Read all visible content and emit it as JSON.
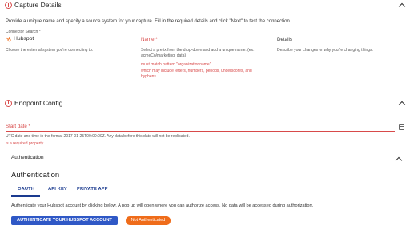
{
  "capture": {
    "title": "Capture Details",
    "intro": "Provide a unique name and specify a source system for your capture. Fill in the required details and click \"Next\" to test the connection.",
    "connector": {
      "label": "Connector Search *",
      "value": "Hubspot",
      "help": "Choose the external system you're connecting to."
    },
    "name": {
      "label": "Name *",
      "help": "Select a prefix from the drop-down and add a unique name. (ex: acmeCo/marketing_data)",
      "error1": "must match pattern \"organizationname\"",
      "error2": "which may include letters, numbers, periods, underscores, and hyphens"
    },
    "details": {
      "label": "Details",
      "help": "Describe your changes or why you're changing things."
    }
  },
  "endpoint": {
    "title": "Endpoint Config",
    "start_date": {
      "label": "Start date *",
      "help": "UTC date and time in the format 2017-01-25T00:00:00Z. Any data before this date will not be replicated.",
      "error": "is a required property"
    },
    "auth_section_label": "Authentication",
    "auth_heading": "Authentication",
    "tabs": [
      "OAUTH",
      "API KEY",
      "PRIVATE APP"
    ],
    "auth_text": "Authenticate your Hubspot account by clicking below. A pop up will open where you can authorize access. No data will be accessed during authorization.",
    "auth_button": "AUTHENTICATE YOUR HUBSPOT ACCOUNT",
    "auth_status": "Not Authenticated"
  },
  "colors": {
    "error": "#d84a4a",
    "primary": "#2f58c6",
    "tab_active": "#1a3a8f",
    "badge": "#ef6c1a"
  },
  "icons": [
    "warning-icon",
    "chevron-up-icon",
    "hubspot-icon",
    "calendar-icon"
  ]
}
